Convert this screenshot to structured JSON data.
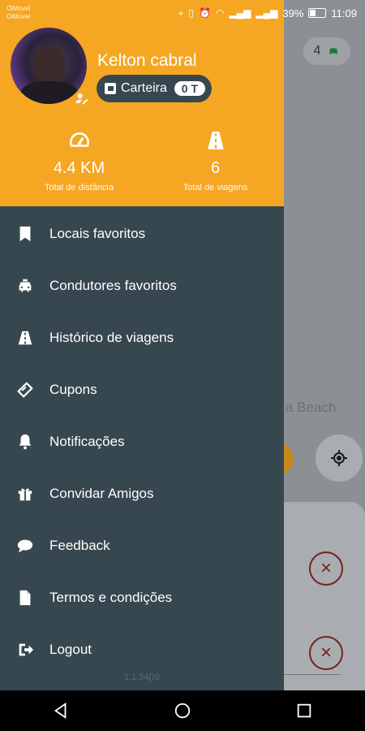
{
  "status": {
    "carrier_line1": "OiMovel",
    "carrier_line2": "OiMovel",
    "battery": "39%",
    "time": "11:09"
  },
  "profile": {
    "name": "Kelton cabral",
    "wallet_label": "Carteira",
    "wallet_amount": "0 T"
  },
  "stats": {
    "distance_value": "4.4 KM",
    "distance_label": "Total de distância",
    "trips_value": "6",
    "trips_label": "Total de viagens"
  },
  "menu": [
    {
      "label": "Locais favoritos",
      "icon": "bookmark-icon"
    },
    {
      "label": "Condutores favoritos",
      "icon": "taxi-icon"
    },
    {
      "label": "Histórico de viagens",
      "icon": "road-icon"
    },
    {
      "label": "Cupons",
      "icon": "ticket-icon"
    },
    {
      "label": "Notificações",
      "icon": "bell-icon"
    },
    {
      "label": "Convidar Amigos",
      "icon": "gift-icon"
    },
    {
      "label": "Feedback",
      "icon": "chat-icon"
    },
    {
      "label": "Termos e condições",
      "icon": "document-icon"
    },
    {
      "label": "Logout",
      "icon": "logout-icon"
    }
  ],
  "version": "1.1.54(r0",
  "map": {
    "vehicle_count": "4",
    "place_label": "a Beach"
  },
  "colors": {
    "header": "#f5a623",
    "drawer": "#37474f",
    "navbar": "#000000"
  }
}
